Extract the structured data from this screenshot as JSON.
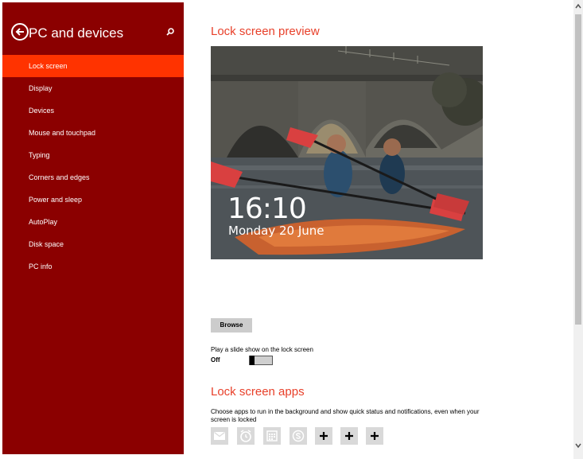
{
  "sidebar": {
    "title": "PC and devices",
    "items": [
      {
        "label": "Lock screen",
        "active": true
      },
      {
        "label": "Display"
      },
      {
        "label": "Devices"
      },
      {
        "label": "Mouse and touchpad"
      },
      {
        "label": "Typing"
      },
      {
        "label": "Corners and edges"
      },
      {
        "label": "Power and sleep"
      },
      {
        "label": "AutoPlay"
      },
      {
        "label": "Disk space"
      },
      {
        "label": "PC info"
      }
    ],
    "back_icon": "back-arrow-icon",
    "search_icon": "search-icon"
  },
  "main": {
    "preview_heading": "Lock screen preview",
    "preview_time": "16:10",
    "preview_date": "Monday 20 June",
    "browse_label": "Browse",
    "slideshow_label": "Play a slide show on the lock screen",
    "slideshow_value": "Off",
    "apps_heading": "Lock screen apps",
    "apps_description": "Choose apps to run in the background and show quick status and notifications, even when your screen is locked",
    "apps": [
      "mail-icon",
      "alarm-icon",
      "calendar-icon",
      "skype-icon",
      "add-icon",
      "add-icon",
      "add-icon"
    ]
  },
  "colors": {
    "sidebar_bg": "#8b0000",
    "active_item": "#ff3300",
    "accent": "#e8402a"
  }
}
